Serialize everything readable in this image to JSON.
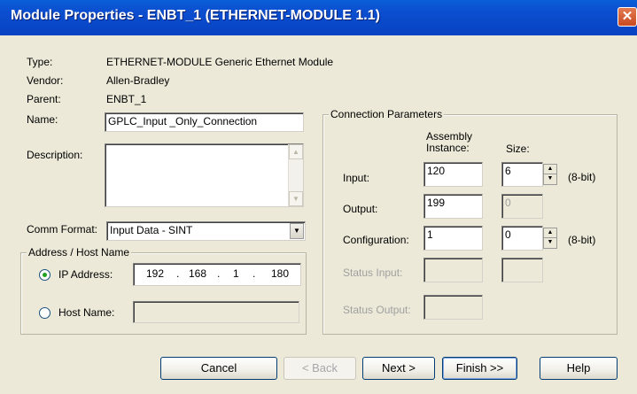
{
  "window": {
    "title": "Module Properties - ENBT_1 (ETHERNET-MODULE 1.1)",
    "close_glyph": "✕"
  },
  "info": {
    "type_label": "Type:",
    "type_value": "ETHERNET-MODULE Generic Ethernet Module",
    "vendor_label": "Vendor:",
    "vendor_value": "Allen-Bradley",
    "parent_label": "Parent:",
    "parent_value": "ENBT_1",
    "name_label": "Name:",
    "name_value": "GPLC_Input _Only_Connection",
    "description_label": "Description:",
    "description_value": ""
  },
  "comm_format": {
    "label": "Comm Format:",
    "value": "Input Data - SINT"
  },
  "address": {
    "group_title": "Address / Host Name",
    "ip_label": "IP Address:",
    "ip_octets": [
      "192",
      "168",
      "1",
      "180"
    ],
    "host_label": "Host Name:",
    "host_value": "",
    "selected": "ip"
  },
  "connection": {
    "group_title": "Connection Parameters",
    "assembly_header": "Assembly\nInstance:",
    "size_header": "Size:",
    "input_label": "Input:",
    "input_instance": "120",
    "input_size": "6",
    "input_unit": "(8-bit)",
    "output_label": "Output:",
    "output_instance": "199",
    "output_size": "0",
    "config_label": "Configuration:",
    "config_instance": "1",
    "config_size": "0",
    "config_unit": "(8-bit)",
    "status_input_label": "Status Input:",
    "status_output_label": "Status Output:"
  },
  "buttons": {
    "cancel": "Cancel",
    "back": "< Back",
    "next": "Next >",
    "finish": "Finish >>",
    "help": "Help"
  },
  "colors": {
    "title_bar": "#0b4fd0",
    "dialog_bg": "#ece9d8",
    "close_button": "#c94a20"
  }
}
